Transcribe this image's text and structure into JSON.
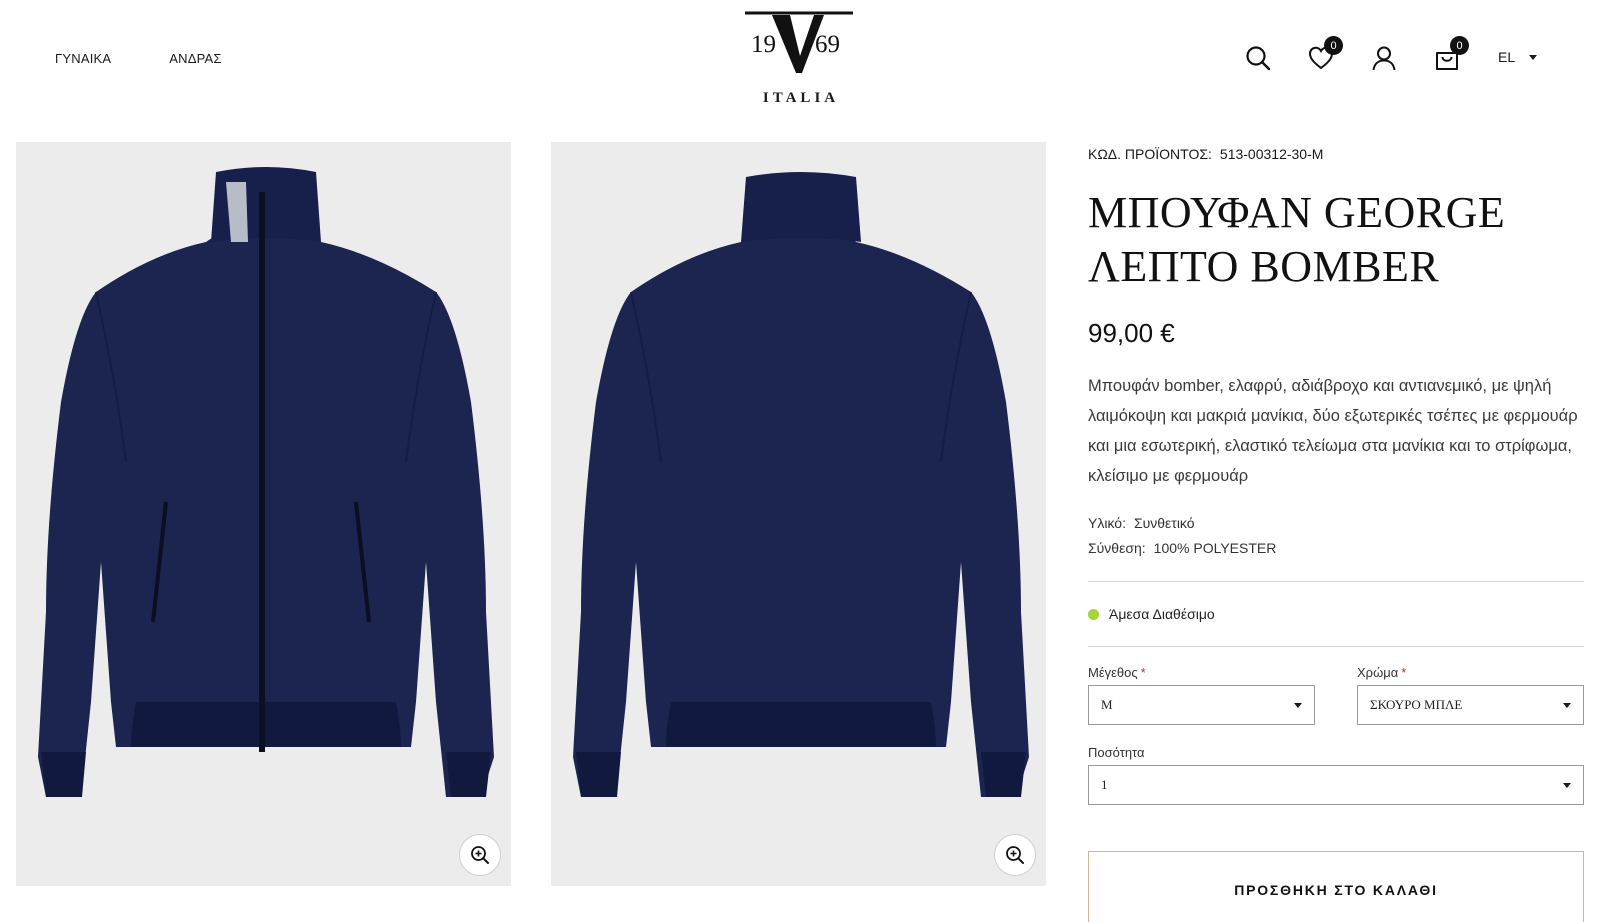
{
  "nav": {
    "items": [
      {
        "label": "ΓΥΝΑΙΚΑ"
      },
      {
        "label": "ΑΝΔΡΑΣ"
      }
    ]
  },
  "logo": {
    "year_left": "19",
    "year_right": "69",
    "tagline": "ITALIA"
  },
  "header": {
    "wishlist_count": "0",
    "cart_count": "0",
    "language": "EL"
  },
  "product": {
    "sku_label": "ΚΩΔ. ΠΡΟΪΟΝΤΟΣ:",
    "sku_value": "513-00312-30-M",
    "title_line1": "ΜΠΟΥΦΑΝ GEORGE",
    "title_line2": "ΛΕΠΤΟ BOMBER",
    "price": "99,00 €",
    "description": "Μπουφάν bomber, ελαφρύ, αδιάβροχο και αντιανεμικό, με ψηλή λαιμόκοψη και μακριά μανίκια, δύο εξωτερικές τσέπες με φερμουάρ και μια εσωτερική, ελαστικό τελείωμα στα μανίκια και το στρίφωμα, κλείσιμο με φερμουάρ",
    "material_label": "Υλικό:",
    "material_value": "Συνθετικό",
    "composition_label": "Σύνθεση:",
    "composition_value": "100% POLYESTER",
    "availability": "Άμεσα Διαθέσιμο",
    "availability_color": "#a5d33a"
  },
  "options": {
    "size_label": "Μέγεθος",
    "size_value": "M",
    "color_label": "Χρώμα",
    "color_value": "ΣΚΟΥΡΟ ΜΠΛΕ",
    "quantity_label": "Ποσότητα",
    "quantity_value": "1",
    "required_mark": "*"
  },
  "actions": {
    "add_to_cart_label": "ΠΡΟΣΘΗΚΗ ΣΤΟ ΚΑΛΑΘΙ"
  },
  "gallery": {
    "images": [
      {
        "icon": "jacket-front-image"
      },
      {
        "icon": "jacket-back-image"
      }
    ],
    "zoom_icon": "zoom-in-icon"
  },
  "colors": {
    "jacket_navy": "#1b2550",
    "image_bg": "#ececec",
    "button_border": "#cbb99a",
    "required": "#d32020"
  }
}
